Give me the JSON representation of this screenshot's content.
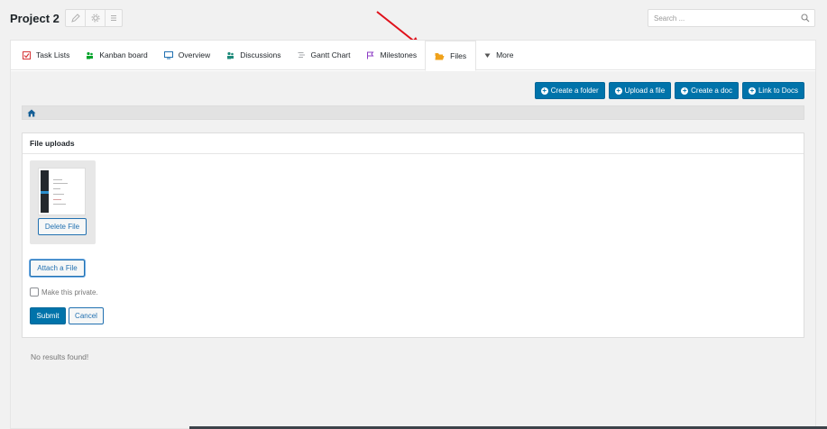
{
  "header": {
    "project_title": "Project 2",
    "tools": [
      {
        "icon": "pencil-icon"
      },
      {
        "icon": "gear-icon"
      },
      {
        "icon": "list-icon"
      }
    ],
    "search": {
      "placeholder": "Search ...",
      "value": ""
    }
  },
  "tabs": [
    {
      "label": "Task Lists",
      "icon": "task-list-icon",
      "color": "#d63638",
      "active": false
    },
    {
      "label": "Kanban board",
      "icon": "kanban-icon",
      "color": "#00a32a",
      "active": false
    },
    {
      "label": "Overview",
      "icon": "overview-icon",
      "color": "#2271b1",
      "active": false
    },
    {
      "label": "Discussions",
      "icon": "discussions-icon",
      "color": "#1e8a7a",
      "active": false
    },
    {
      "label": "Gantt Chart",
      "icon": "gantt-icon",
      "color": "#a7aaad",
      "active": false
    },
    {
      "label": "Milestones",
      "icon": "milestone-flag-icon",
      "color": "#8c3cc5",
      "active": false
    },
    {
      "label": "Files",
      "icon": "folder-open-icon",
      "color": "#f0a21b",
      "active": true
    },
    {
      "label": "More",
      "icon": "caret-down-icon",
      "color": "#555555",
      "active": false
    }
  ],
  "actions": [
    {
      "label": "Create a folder"
    },
    {
      "label": "Upload a file"
    },
    {
      "label": "Create a doc"
    },
    {
      "label": "Link to Docs"
    }
  ],
  "breadcrumb": {
    "icon": "home-icon"
  },
  "uploads": {
    "title": "File uploads",
    "delete_label": "Delete File",
    "attach_label": "Attach a File",
    "private_label": "Make this private.",
    "private_checked": false,
    "submit_label": "Submit",
    "cancel_label": "Cancel"
  },
  "no_results": "No results found!",
  "colors": {
    "primary": "#0073aa",
    "link": "#2271b1",
    "annotation_arrow": "#e0101a"
  }
}
